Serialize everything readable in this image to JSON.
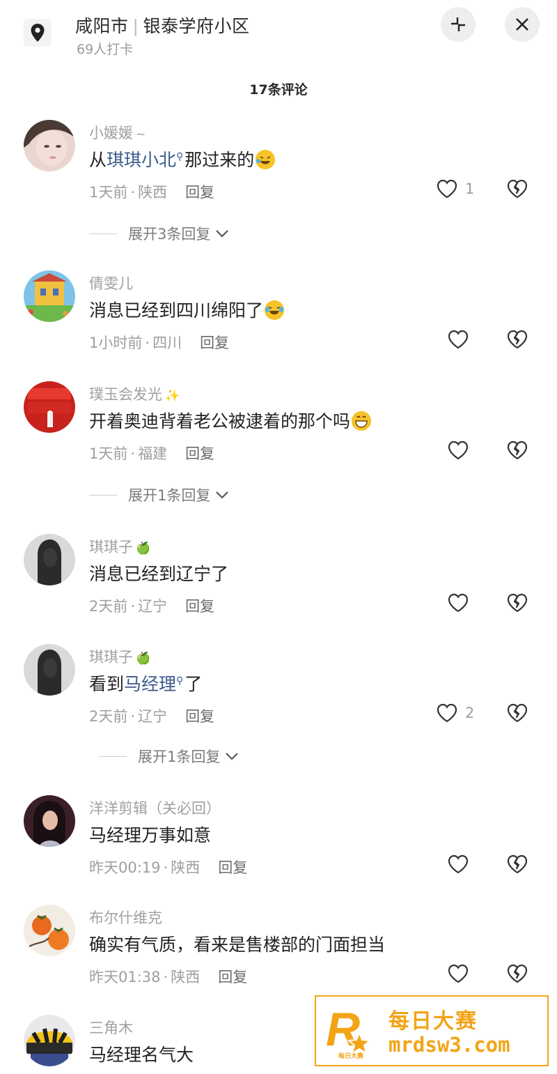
{
  "header": {
    "city": "咸阳市",
    "community": "银泰学府小区",
    "checkins": "69人打卡",
    "comment_count": "17条评论"
  },
  "comments": [
    {
      "user": "小媛媛",
      "user_suffix": "~",
      "text_pre": "从",
      "text_link": "琪琪小北",
      "text_post": "那过来的",
      "emoji": "laughing-emoji",
      "time": "1天前",
      "region": "陕西",
      "reply": "回复",
      "likes": "1",
      "expand": "展开3条回复"
    },
    {
      "user": "倩雯儿",
      "text": "消息已经到四川绵阳了",
      "emoji": "laughing-crying-emoji",
      "time": "1小时前",
      "region": "四川",
      "reply": "回复"
    },
    {
      "user": "璞玉会发光",
      "user_suffix": "✨",
      "text": "开着奥迪背着老公被逮着的那个吗",
      "emoji": "grinning-emoji",
      "time": "1天前",
      "region": "福建",
      "reply": "回复",
      "expand": "展开1条回复"
    },
    {
      "user": "琪琪子",
      "user_suffix": "🍏",
      "text": "消息已经到辽宁了",
      "time": "2天前",
      "region": "辽宁",
      "reply": "回复"
    },
    {
      "user": "琪琪子",
      "user_suffix": "🍏",
      "text_pre": "看到",
      "text_link": "马经理",
      "text_post": "了",
      "time": "2天前",
      "region": "辽宁",
      "reply": "回复",
      "likes": "2",
      "expand": "展开1条回复"
    },
    {
      "user": "洋洋剪辑（关必回）",
      "text": "马经理万事如意",
      "time": "昨天00:19",
      "region": "陕西",
      "reply": "回复"
    },
    {
      "user": "布尔什维克",
      "text": "确实有气质，看来是售楼部的门面担当",
      "time": "昨天01:38",
      "region": "陕西",
      "reply": "回复"
    },
    {
      "user": "三角木",
      "text": "马经理名气大"
    }
  ],
  "watermark": {
    "name": "每日大赛",
    "url": "mrdsw3.com",
    "logo_letter": "R",
    "logo_small": "每日大赛"
  },
  "colors": {
    "link": "#3c5a8a",
    "watermark": "#f2a416",
    "meta": "#9e9e9e"
  }
}
